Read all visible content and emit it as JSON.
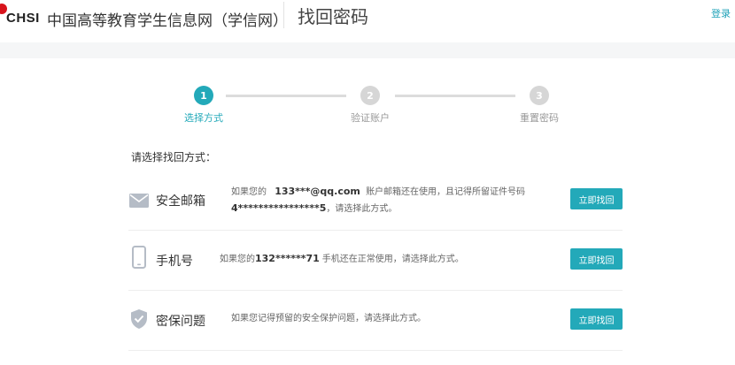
{
  "header": {
    "logo": "CHSI",
    "site_name": "中国高等教育学生信息网（学信网）",
    "page_title": "找回密码",
    "login": "登录"
  },
  "steps": [
    {
      "number": "1",
      "label": "选择方式",
      "active": true
    },
    {
      "number": "2",
      "label": "验证账户",
      "active": false
    },
    {
      "number": "3",
      "label": "重置密码",
      "active": false
    }
  ],
  "section_title": "请选择找回方式：",
  "methods": {
    "email": {
      "name": "安全邮箱",
      "desc_prefix": "如果您的",
      "email": "133***@qq.com",
      "desc_mid": "账户邮箱还在使用，且记得所留证件号码",
      "id_number": "4****************5",
      "desc_suffix": "，请选择此方式。",
      "button": "立即找回"
    },
    "phone": {
      "name": "手机号",
      "desc_prefix": "如果您的",
      "phone": "132******71",
      "desc_suffix": "手机还在正常使用，请选择此方式。",
      "button": "立即找回"
    },
    "security_question": {
      "name": "密保问题",
      "desc": "如果您记得预留的安全保护问题，请选择此方式。",
      "button": "立即找回"
    }
  },
  "colors": {
    "accent": "#23a9b9",
    "logo_red": "#d8141c",
    "inactive_step": "#d6d6d6"
  },
  "icons": {
    "email": "envelope-icon",
    "phone": "mobile-phone-icon",
    "security_question": "shield-check-icon"
  }
}
